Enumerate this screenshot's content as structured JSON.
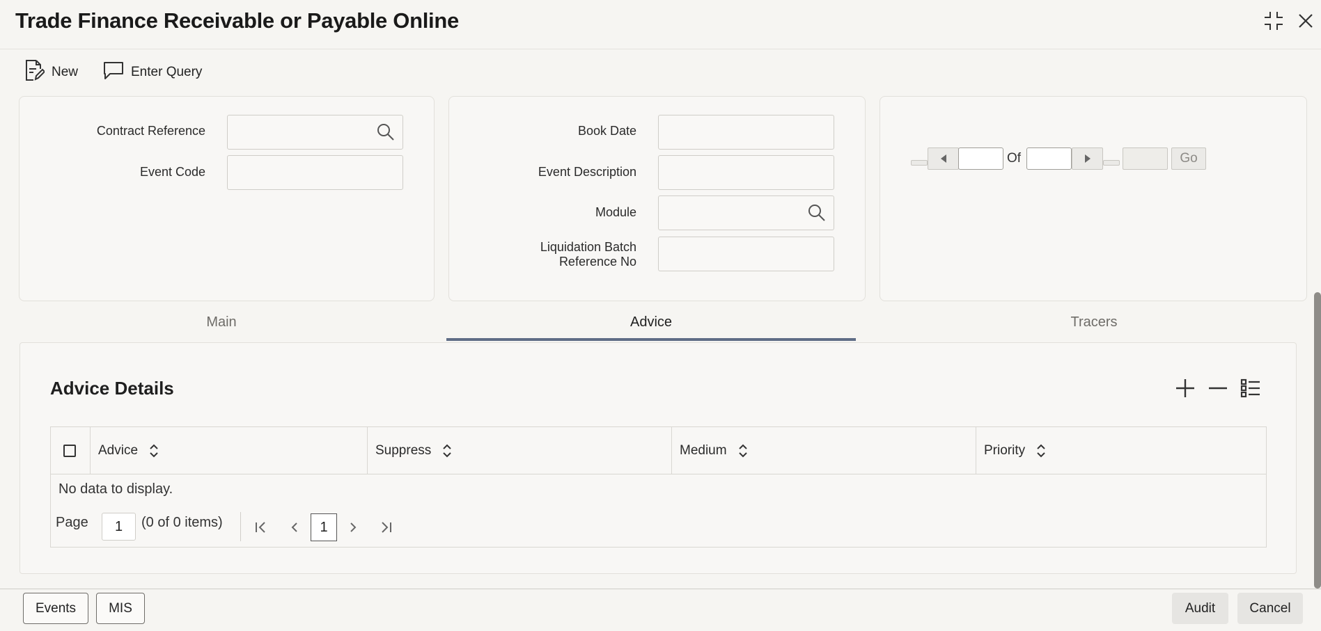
{
  "window": {
    "title": "Trade Finance Receivable or Payable Online"
  },
  "toolbar": {
    "new_label": "New",
    "enter_query_label": "Enter Query"
  },
  "form": {
    "contract_reference_label": "Contract Reference",
    "event_code_label": "Event Code",
    "book_date_label": "Book Date",
    "event_description_label": "Event Description",
    "module_label": "Module",
    "liquidation_batch_label_line1": "Liquidation Batch",
    "liquidation_batch_label_line2": "Reference No"
  },
  "record_nav": {
    "of_label": "Of",
    "go_label": "Go"
  },
  "tabs": [
    {
      "label": "Main",
      "active": false
    },
    {
      "label": "Advice",
      "active": true
    },
    {
      "label": "Tracers",
      "active": false
    }
  ],
  "advice": {
    "title": "Advice Details",
    "columns": [
      "Advice",
      "Suppress",
      "Medium",
      "Priority"
    ],
    "empty_message": "No data to display.",
    "pagination": {
      "page_label": "Page",
      "page_value": "1",
      "items_text": "(0 of 0 items)",
      "current_page": "1"
    }
  },
  "footer": {
    "events_label": "Events",
    "mis_label": "MIS",
    "audit_label": "Audit",
    "cancel_label": "Cancel"
  },
  "colors": {
    "accent": "#5f6d86",
    "background": "#f6f5f2"
  }
}
